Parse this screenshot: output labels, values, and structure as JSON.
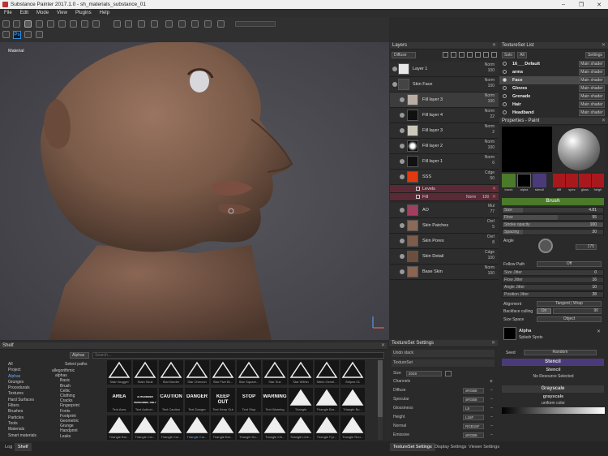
{
  "window": {
    "title": "Substance Painter 2017.1.0 - sh_materials_substance_01",
    "minimize": "–",
    "maximize": "❐",
    "close": "✕"
  },
  "menu": [
    "File",
    "Edit",
    "Mode",
    "View",
    "Plugins",
    "Help"
  ],
  "toolbar": {
    "ps_label": "Ps"
  },
  "viewport": {
    "label": "Material"
  },
  "layers": {
    "title": "Layers",
    "channel": "Diffuse",
    "items": [
      {
        "name": "Layer 1",
        "blend": "Norm",
        "opacity": "100"
      },
      {
        "name": "Skin Face",
        "blend": "Norm",
        "opacity": "100"
      },
      {
        "name": "Fill layer 3",
        "blend": "Norm",
        "opacity": "100"
      },
      {
        "name": "Fill layer 4",
        "blend": "Norm",
        "opacity": "22"
      },
      {
        "name": "Fill layer 3",
        "blend": "Norm",
        "opacity": "2"
      },
      {
        "name": "Fill layer 2",
        "blend": "Norm",
        "opacity": "100"
      },
      {
        "name": "Fill layer 1",
        "blend": "Norm",
        "opacity": "6"
      },
      {
        "name": "SSS",
        "blend": "Cdge",
        "opacity": "50"
      },
      {
        "name": "AO",
        "blend": "Mul",
        "opacity": "77"
      },
      {
        "name": "Skin Patches",
        "blend": "Ovrl",
        "opacity": "5"
      },
      {
        "name": "Skin Pores",
        "blend": "Ovrl",
        "opacity": "8"
      },
      {
        "name": "Skin Detail",
        "blend": "Cdge",
        "opacity": "100"
      },
      {
        "name": "Base Skin",
        "blend": "Norm",
        "opacity": "100"
      }
    ],
    "effects": [
      {
        "name": "Levels"
      },
      {
        "name": "Fill",
        "blend": "Norm",
        "opacity": "100"
      }
    ]
  },
  "textureset_list": {
    "title": "TextureSet List",
    "solo": "Solo",
    "all": "All",
    "settings": "Settings",
    "items": [
      {
        "name": "16___Default",
        "shader": "Main shader"
      },
      {
        "name": "arms",
        "shader": "Main shader"
      },
      {
        "name": "Face",
        "shader": "Main shader"
      },
      {
        "name": "Gloves",
        "shader": "Main shader"
      },
      {
        "name": "Grenade",
        "shader": "Main shader"
      },
      {
        "name": "Hair",
        "shader": "Main shader"
      },
      {
        "name": "Headband",
        "shader": "Main shader"
      }
    ]
  },
  "properties": {
    "title": "Properties - Paint",
    "thumbs": [
      "brush",
      "alpha",
      "stencil",
      "diff",
      "spec",
      "gloss",
      "heigh"
    ],
    "brush_header": "Brush",
    "rows": [
      {
        "label": "Size",
        "value": "4.81",
        "pct": 20
      },
      {
        "label": "Flow",
        "value": "55",
        "pct": 55
      },
      {
        "label": "Stroke opacity",
        "value": "100",
        "pct": 100
      },
      {
        "label": "Spacing",
        "value": "20",
        "pct": 20
      }
    ],
    "angle_label": "Angle",
    "angle_value": "175",
    "follow_path": "Follow Path",
    "follow_value": "Off",
    "jitter": [
      {
        "label": "Size Jitter",
        "value": "0"
      },
      {
        "label": "Flow Jitter",
        "value": "16"
      },
      {
        "label": "Angle Jitter",
        "value": "10"
      },
      {
        "label": "Position Jitter",
        "value": "28"
      }
    ],
    "alignment_label": "Alignment",
    "alignment_value": "Tangent | Wrap",
    "backface_label": "Backface culling",
    "backface_on": "On",
    "backface_value": "90",
    "size_space_label": "Size Space",
    "size_space_value": "Object",
    "alpha_label": "Alpha",
    "alpha_name": "Splash Spots",
    "seed_label": "Seed",
    "seed_value": "Random",
    "stencil_header": "Stencil",
    "stencil_name": "Stencil",
    "stencil_value": "No Resource Selected",
    "grayscale_header": "Grayscale",
    "grayscale_name": "grayscale",
    "grayscale_value": "uniform color"
  },
  "shelf": {
    "title": "Shelf",
    "filter": "Alphas",
    "search_placeholder": "Search...",
    "select_paths": "Select paths",
    "categories": [
      "All",
      "Project",
      "Alphas",
      "Grunges",
      "Procedurals",
      "Textures",
      "Hard Surfaces",
      "Filters",
      "Brushes",
      "Particles",
      "Tools",
      "Materials",
      "Smart materials"
    ],
    "tree": [
      "allegorithmic",
      "alphas",
      "Basic",
      "Brush",
      "Celtic",
      "Clothing",
      "Cracks",
      "Fingerprint",
      "Fonts",
      "Footprint",
      "Geometric",
      "Grunge",
      "Handprint",
      "Leaks"
    ],
    "row1": [
      "Stain Nugget",
      "Stain Skull",
      "Star Border",
      "Star Chevron",
      "Star Five Br...",
      "Star Square...",
      "Star Sun",
      "Star Within",
      "Stitch Genel...",
      "Stripes 01"
    ],
    "row2": [
      {
        "t": "AREA",
        "l": "Text Area"
      },
      {
        "t": "AUTHORIZED PERSONNEL ONLY",
        "l": "Text Authori..."
      },
      {
        "t": "CAUTION",
        "l": "Text Caution"
      },
      {
        "t": "DANGER",
        "l": "Text Danger"
      },
      {
        "t": "KEEP OUT",
        "l": "Text Keep Out"
      },
      {
        "t": "STOP",
        "l": "Text Stop"
      },
      {
        "t": "WARNING",
        "l": "Text Warning"
      },
      {
        "t": "",
        "l": "Triangle"
      },
      {
        "t": "",
        "l": "Triangle Bor..."
      },
      {
        "t": "",
        "l": "Triangle Bo..."
      }
    ],
    "row3": [
      "Triangle Bor...",
      "Triangle Cor...",
      "Triangle Cor...",
      "Triangle Cur...",
      "Triangle Bor...",
      "Triangle Do...",
      "Triangle Infi...",
      "Triangle Line...",
      "Triangle Pyr...",
      "Triangle Rou..."
    ]
  },
  "textureset_settings": {
    "title": "TextureSet Settings",
    "undo": "Undo stack",
    "ts": "TextureSet",
    "size_label": "Size",
    "size_value": "2048",
    "channels_label": "Channels",
    "channels": [
      {
        "name": "Diffuse",
        "format": "sRGB8"
      },
      {
        "name": "Specular",
        "format": "sRGB8"
      },
      {
        "name": "Glossiness",
        "format": "L8"
      },
      {
        "name": "Height",
        "format": "L16F"
      },
      {
        "name": "Normal",
        "format": "RGB16F"
      },
      {
        "name": "Emissive",
        "format": "sRGB8"
      }
    ]
  },
  "bottom_tabs": {
    "left": [
      "Log",
      "Shelf"
    ],
    "right": [
      "TextureSet Settings",
      "Display Settings",
      "Viewer Settings"
    ]
  },
  "colors": {
    "brush_green": "#4a7a2a",
    "stencil_purple": "#4b3a7a",
    "highlight_pink": "#5a2a36"
  }
}
